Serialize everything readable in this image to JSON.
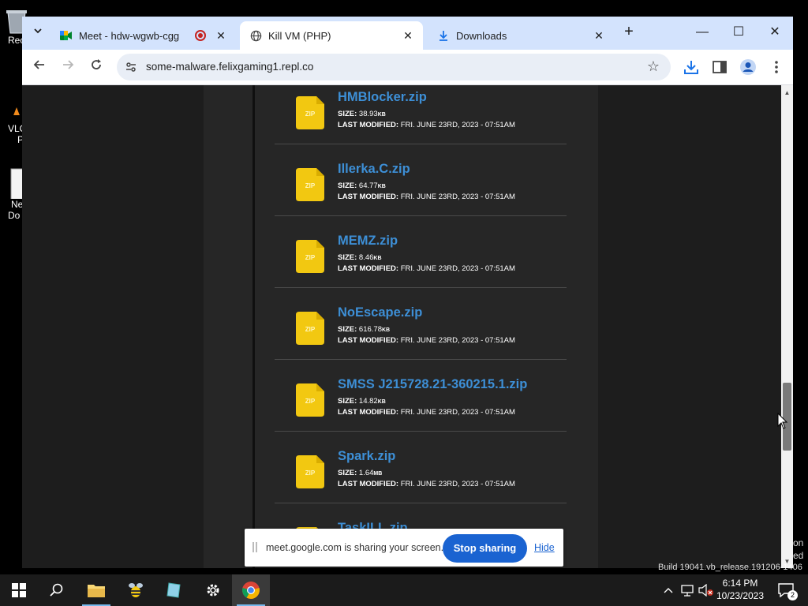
{
  "desktop": {
    "icons": [
      {
        "label": "Rec"
      },
      {
        "label": "VLC"
      },
      {
        "label": "Ne"
      }
    ],
    "icon_extra": [
      "P",
      "Do"
    ]
  },
  "browser": {
    "tabs": [
      {
        "title": "Meet - hdw-wgwb-cgg",
        "recording": true
      },
      {
        "title": "Kill VM (PHP)",
        "active": true
      },
      {
        "title": "Downloads"
      }
    ],
    "url": "some-malware.felixgaming1.repl.co",
    "new_tab_symbol": "+",
    "window_controls": {
      "minimize": "—",
      "maximize": "☐",
      "close": "✕"
    }
  },
  "files": [
    {
      "name": "HMBlocker.zip",
      "size_label": "SIZE:",
      "size": "38.93",
      "unit": "KB",
      "mod_label": "LAST MODIFIED:",
      "modified": "FRI. JUNE 23RD, 2023 - 07:51AM"
    },
    {
      "name": "Illerka.C.zip",
      "size_label": "SIZE:",
      "size": "64.77",
      "unit": "KB",
      "mod_label": "LAST MODIFIED:",
      "modified": "FRI. JUNE 23RD, 2023 - 07:51AM"
    },
    {
      "name": "MEMZ.zip",
      "size_label": "SIZE:",
      "size": "8.46",
      "unit": "KB",
      "mod_label": "LAST MODIFIED:",
      "modified": "FRI. JUNE 23RD, 2023 - 07:51AM"
    },
    {
      "name": "NoEscape.zip",
      "size_label": "SIZE:",
      "size": "616.78",
      "unit": "KB",
      "mod_label": "LAST MODIFIED:",
      "modified": "FRI. JUNE 23RD, 2023 - 07:51AM"
    },
    {
      "name": "SMSS J215728.21-360215.1.zip",
      "size_label": "SIZE:",
      "size": "14.82",
      "unit": "KB",
      "mod_label": "LAST MODIFIED:",
      "modified": "FRI. JUNE 23RD, 2023 - 07:51AM"
    },
    {
      "name": "Spark.zip",
      "size_label": "SIZE:",
      "size": "1.64",
      "unit": "MB",
      "mod_label": "LAST MODIFIED:",
      "modified": "FRI. JUNE 23RD, 2023 - 07:51AM"
    },
    {
      "name": "TaskILL.zip",
      "size_label": "",
      "size": "",
      "unit": "",
      "mod_label": "",
      "modified": ""
    }
  ],
  "zip_badge": "ZIP",
  "sharebar": {
    "message": "meet.google.com is sharing your screen.",
    "stop_label": "Stop sharing",
    "hide_label": "Hide"
  },
  "taskbar": {
    "time": "6:14 PM",
    "date": "10/23/2023",
    "notification_count": "2"
  },
  "watermark": {
    "line1": "on",
    "line2": "ed",
    "build": "Build 19041.vb_release.191206-1406"
  },
  "colors": {
    "link": "#3d8fd6",
    "zip_icon": "#f2c811",
    "accent": "#1a63d1",
    "tab_bar": "#d3e3fd"
  }
}
